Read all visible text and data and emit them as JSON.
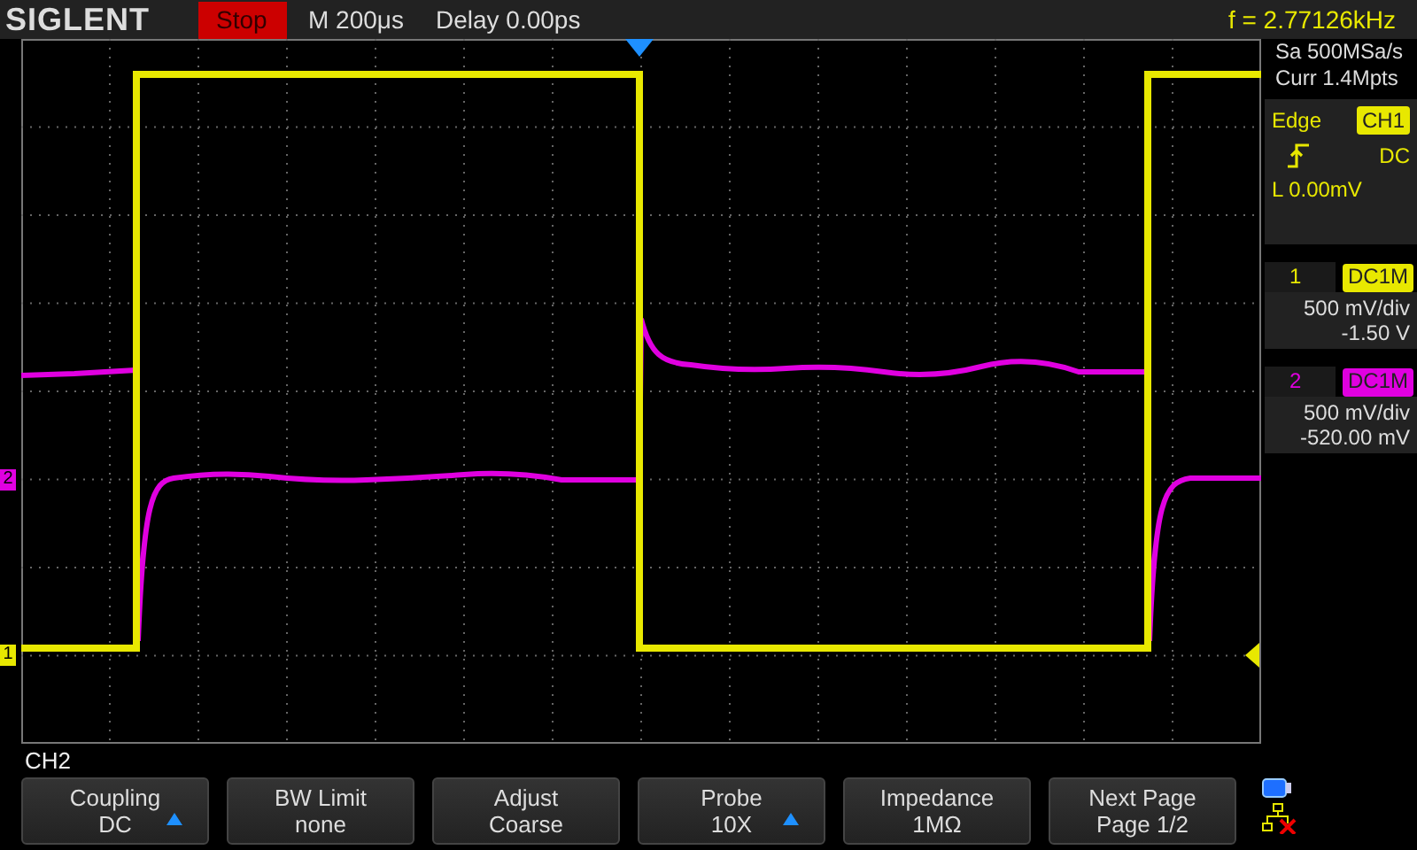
{
  "header": {
    "brand": "SIGLENT",
    "run_state": "Stop",
    "timebase": "M 200μs",
    "delay": "Delay 0.00ps",
    "frequency": "f = 2.77126kHz"
  },
  "acquisition": {
    "sample_rate": "Sa 500MSa/s",
    "memory_depth": "Curr 1.4Mpts"
  },
  "trigger": {
    "type": "Edge",
    "source": "CH1",
    "coupling": "DC",
    "level": "L  0.00mV"
  },
  "channels": [
    {
      "number": "1",
      "coupling": "DC1M",
      "scale": "500 mV/div",
      "offset": "-1.50 V",
      "color": "#e8e800"
    },
    {
      "number": "2",
      "coupling": "DC1M",
      "scale": "500 mV/div",
      "offset": "-520.00 mV",
      "color": "#e000e0"
    }
  ],
  "channel_markers": [
    {
      "label": "2",
      "color": "#e000e0"
    },
    {
      "label": "1",
      "color": "#e8e800"
    }
  ],
  "menu": {
    "title": "CH2",
    "buttons": [
      {
        "label": "Coupling",
        "value": "DC",
        "adjustable": true
      },
      {
        "label": "BW Limit",
        "value": "none",
        "adjustable": false
      },
      {
        "label": "Adjust",
        "value": "Coarse",
        "adjustable": false
      },
      {
        "label": "Probe",
        "value": "10X",
        "adjustable": true
      },
      {
        "label": "Impedance",
        "value": "1MΩ",
        "adjustable": false
      },
      {
        "label": "Next Page",
        "value": "Page 1/2",
        "adjustable": false
      }
    ]
  }
}
